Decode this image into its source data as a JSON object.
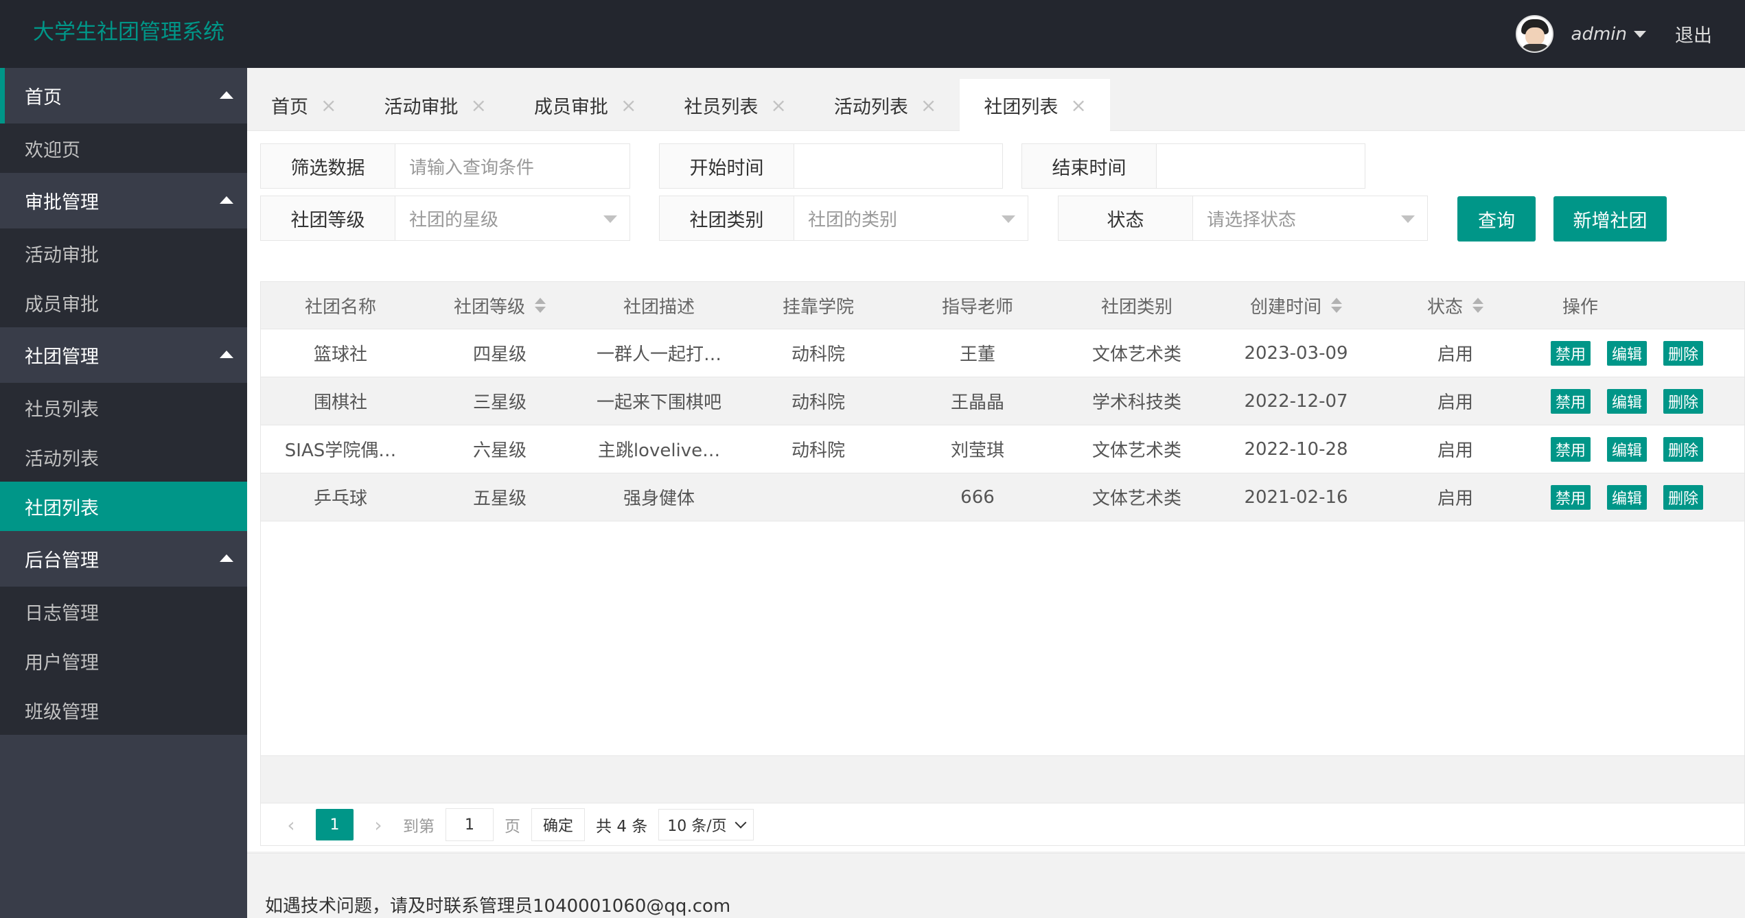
{
  "app": {
    "title": "大学生社团管理系统"
  },
  "user": {
    "name": "admin",
    "logout": "退出"
  },
  "sidebar": {
    "groups": [
      {
        "label": "首页",
        "items": [
          "欢迎页"
        ]
      },
      {
        "label": "审批管理",
        "items": [
          "活动审批",
          "成员审批"
        ]
      },
      {
        "label": "社团管理",
        "items": [
          "社员列表",
          "活动列表",
          "社团列表"
        ]
      },
      {
        "label": "后台管理",
        "items": [
          "日志管理",
          "用户管理",
          "班级管理"
        ]
      }
    ],
    "active_item": "社团列表"
  },
  "tabs": [
    "首页",
    "活动审批",
    "成员审批",
    "社员列表",
    "活动列表",
    "社团列表"
  ],
  "active_tab": "社团列表",
  "filters": {
    "filter_label": "筛选数据",
    "filter_placeholder": "请输入查询条件",
    "start_label": "开始时间",
    "start_value": "",
    "end_label": "结束时间",
    "end_value": "",
    "level_label": "社团等级",
    "level_placeholder": "社团的星级",
    "category_label": "社团类别",
    "category_placeholder": "社团的类别",
    "status_label": "状态",
    "status_placeholder": "请选择状态",
    "query_button": "查询",
    "add_button": "新增社团"
  },
  "table": {
    "columns": [
      "社团名称",
      "社团等级",
      "社团描述",
      "挂靠学院",
      "指导老师",
      "社团类别",
      "创建时间",
      "状态",
      "操作"
    ],
    "rows": [
      {
        "name": "篮球社",
        "level": "四星级",
        "desc": "一群人一起打…",
        "college": "动科院",
        "teacher": "王董",
        "category": "文体艺术类",
        "created": "2023-03-09",
        "status": "启用"
      },
      {
        "name": "围棋社",
        "level": "三星级",
        "desc": "一起来下围棋吧",
        "college": "动科院",
        "teacher": "王晶晶",
        "category": "学术科技类",
        "created": "2022-12-07",
        "status": "启用"
      },
      {
        "name": "SIAS学院偶…",
        "level": "六星级",
        "desc": "主跳lovelive…",
        "college": "动科院",
        "teacher": "刘莹琪",
        "category": "文体艺术类",
        "created": "2022-10-28",
        "status": "启用"
      },
      {
        "name": "乒乓球",
        "level": "五星级",
        "desc": "强身健体",
        "college": "",
        "teacher": "666",
        "category": "文体艺术类",
        "created": "2021-02-16",
        "status": "启用"
      }
    ],
    "row_actions": {
      "disable": "禁用",
      "edit": "编辑",
      "delete": "删除"
    }
  },
  "pager": {
    "current": "1",
    "goto_label": "到第",
    "goto_value": "1",
    "page_label": "页",
    "confirm": "确定",
    "total": "共 4 条",
    "page_size": "10 条/页"
  },
  "footer": {
    "text": "如遇技术问题，请及时联系管理员1040001060@qq.com"
  }
}
